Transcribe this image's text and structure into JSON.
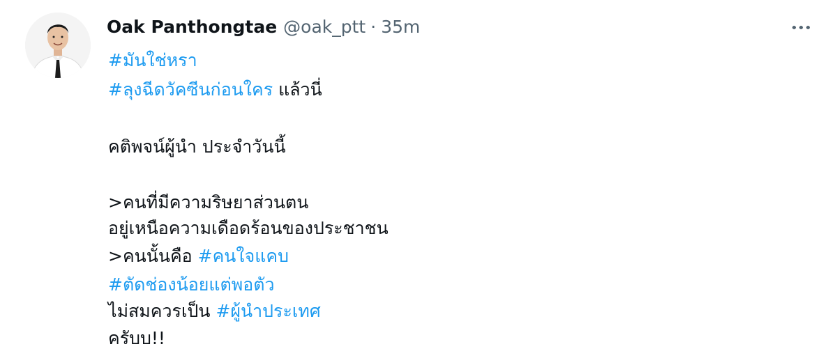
{
  "tweet": {
    "author_name": "Oak Panthongtae",
    "handle": "@oak_ptt",
    "separator": "·",
    "time": "35m",
    "lines": [
      {
        "tag": "#มันใช่หรา",
        "text": ""
      },
      {
        "tag": "#ลุงฉีดวัคซีนก่อนใคร",
        "text": " แล้วนี่"
      },
      {
        "text": "คติพจน์ผู้นำ ประจำวันนี้"
      },
      {
        "text": ">คนที่มีความริษยาส่วนตน"
      },
      {
        "text": "อยู่เหนือความเดือดร้อนของประชาชน"
      },
      {
        "text": ">คนนั้นคือ ",
        "tag": "#คนใจแคบ"
      },
      {
        "tag": "#ตัดช่องน้อยแต่พอตัว",
        "text": ""
      },
      {
        "text": "ไม่สมควรเป็น ",
        "tag": "#ผู้นำประเทศ"
      },
      {
        "text": "ครับบ!!"
      }
    ]
  },
  "icons": {
    "more": "more-horizontal-icon",
    "avatar": "profile-photo"
  },
  "colors": {
    "hashtag": "#1d9bf0",
    "text": "#0f1419",
    "secondary": "#536471"
  }
}
